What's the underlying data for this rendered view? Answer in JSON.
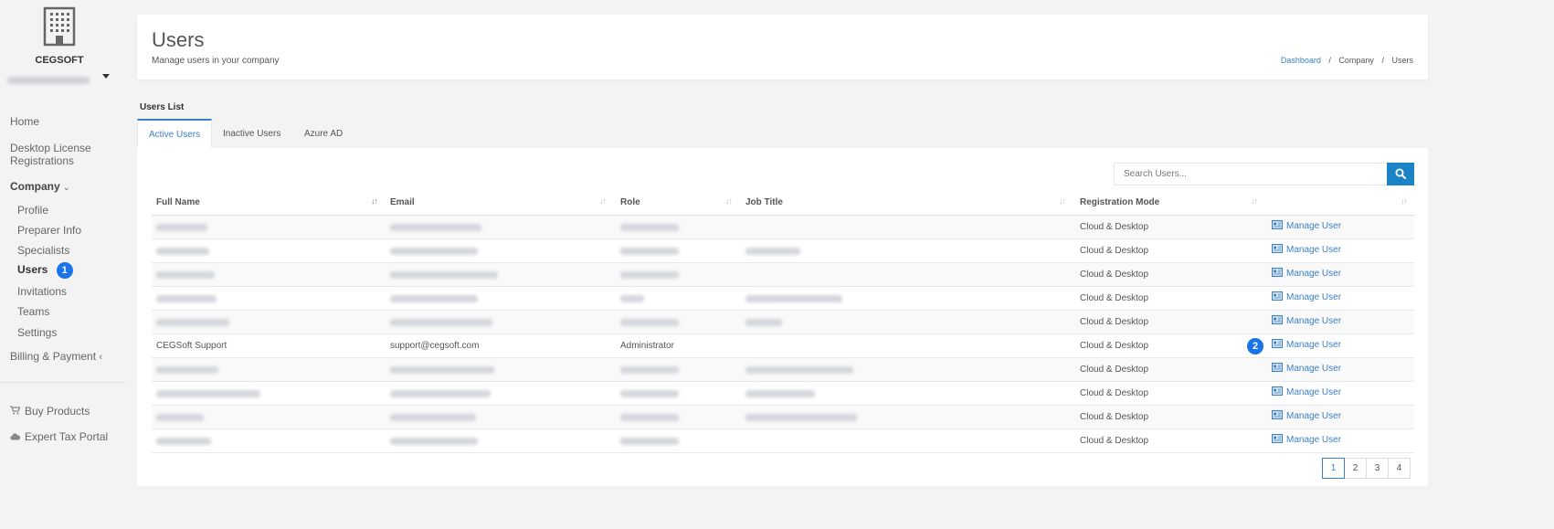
{
  "sidebar": {
    "company_name": "CEGSOFT",
    "nav": {
      "home": "Home",
      "desktop_license_line1": "Desktop License",
      "desktop_license_line2": "Registrations",
      "company": "Company",
      "profile": "Profile",
      "preparer_info": "Preparer Info",
      "specialists": "Specialists",
      "users": "Users",
      "invitations": "Invitations",
      "teams": "Teams",
      "settings": "Settings",
      "billing": "Billing & Payment",
      "buy_products": "Buy Products",
      "expert_tax_portal": "Expert Tax Portal"
    },
    "users_badge": "1"
  },
  "header": {
    "title": "Users",
    "subtitle": "Manage users in your company",
    "breadcrumb": [
      "Dashboard",
      "Company",
      "Users"
    ]
  },
  "section_label": "Users List",
  "tabs": [
    "Active Users",
    "Inactive Users",
    "Azure AD"
  ],
  "search": {
    "placeholder": "Search Users..."
  },
  "table": {
    "columns": [
      "Full Name",
      "Email",
      "Role",
      "Job Title",
      "Registration Mode"
    ],
    "action_label": "Manage User",
    "visible_row": {
      "full_name": "CEGSoft Support",
      "email": "support@cegsoft.com",
      "role": "Administrator"
    },
    "registration_mode": "Cloud & Desktop",
    "row_badge": "2"
  },
  "pagination": [
    "1",
    "2",
    "3",
    "4"
  ],
  "colors": {
    "accent": "#3b7fc4",
    "badge": "#1a73e8",
    "search_button": "#1c84c6"
  },
  "icons": [
    "building-icon",
    "caret-down-icon",
    "chevron-down-icon",
    "chevron-left-icon",
    "cart-icon",
    "cloud-icon",
    "search-icon",
    "id-card-icon",
    "sort-icon"
  ]
}
